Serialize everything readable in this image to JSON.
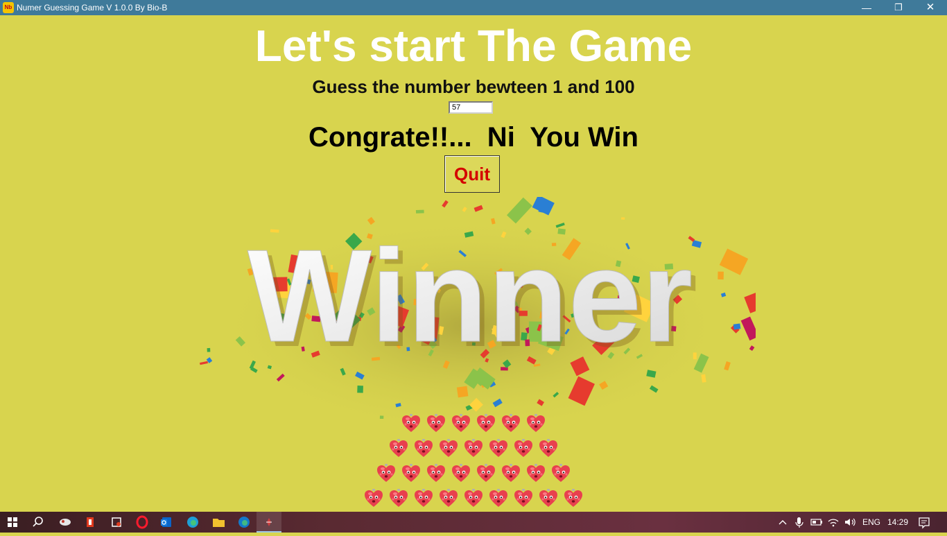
{
  "window": {
    "title": "Numer Guessing Game V 1.0.0 By Bio-B",
    "app_icon_text": "Nb"
  },
  "main": {
    "heading": "Let's start The Game",
    "instruction": "Guess the number bewteen 1 and 100",
    "guess_value": "57",
    "result_message": "Congrate!!...  Ni  You Win",
    "quit_label": "Quit",
    "banner_text": "Winner"
  },
  "hearts": {
    "rows": [
      6,
      7,
      8,
      9
    ]
  },
  "taskbar": {
    "language": "ENG",
    "time": "14:29",
    "pinned": [
      "start-icon",
      "search-icon",
      "app-icon",
      "office-icon",
      "snip-icon",
      "opera-icon",
      "outlook-icon",
      "edge-icon",
      "file-explorer-icon",
      "edge-dev-icon",
      "python-app-icon"
    ]
  },
  "colors": {
    "background": "#d8d44e",
    "title_bar": "#3f7a9a",
    "heading": "#ffffff",
    "quit_text": "#d40000"
  }
}
